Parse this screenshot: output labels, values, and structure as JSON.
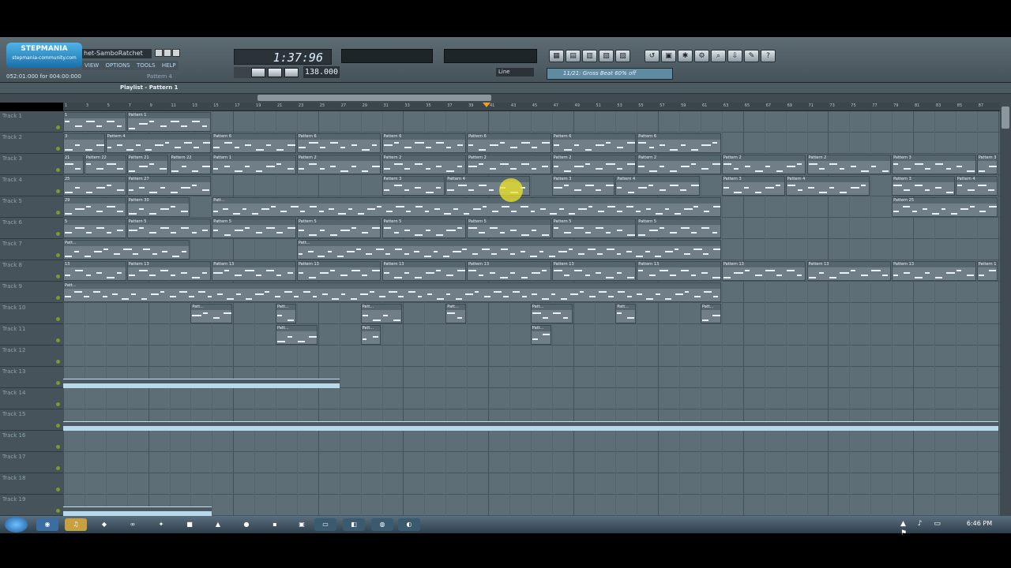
{
  "app": {
    "title": "het-SamboRatchet",
    "logo_line1": "STEPMANIA",
    "logo_line2": "stepmania-community.com",
    "accent": "#7dc2ec"
  },
  "menu": [
    "VIEW",
    "OPTIONS",
    "TOOLS",
    "HELP"
  ],
  "position_readout": "052:01:000 for 004:00:000",
  "pattern_selector": "Pattern 4",
  "song_time": "1:37:96",
  "tempo": "138.000",
  "snap": "Line",
  "hint_bar": "11/21: Gross Beat 60% off",
  "playlist_title": "Playlist - Pattern 1",
  "ruler_ticks": [
    "1",
    "3",
    "5",
    "7",
    "9",
    "11",
    "13",
    "15",
    "17",
    "19",
    "21",
    "23",
    "25",
    "27",
    "29",
    "31",
    "33",
    "35",
    "37",
    "39",
    "41",
    "43",
    "45",
    "47",
    "49",
    "51",
    "53",
    "55",
    "57",
    "59",
    "61",
    "63",
    "65",
    "67",
    "69",
    "71",
    "73",
    "75",
    "77",
    "79",
    "81",
    "83",
    "85",
    "87"
  ],
  "tracks": [
    "Track 1",
    "Track 2",
    "Track 3",
    "Track 4",
    "Track 5",
    "Track 6",
    "Track 7",
    "Track 8",
    "Track 9",
    "Track 10",
    "Track 11",
    "Track 12",
    "Track 13",
    "Track 14",
    "Track 15",
    "Track 16",
    "Track 17",
    "Track 18",
    "Track 19"
  ],
  "clips": [
    {
      "track": 1,
      "start": 0,
      "len": 3,
      "label": "1"
    },
    {
      "track": 1,
      "start": 3,
      "len": 4,
      "label": "Pattern 1"
    },
    {
      "track": 2,
      "start": 0,
      "len": 2,
      "label": "3"
    },
    {
      "track": 2,
      "start": 2,
      "len": 5,
      "label": "Pattern 4"
    },
    {
      "track": 2,
      "start": 7,
      "len": 4,
      "label": "Pattern 6"
    },
    {
      "track": 2,
      "start": 11,
      "len": 4,
      "label": "Pattern 6"
    },
    {
      "track": 2,
      "start": 15,
      "len": 4,
      "label": "Pattern 6"
    },
    {
      "track": 2,
      "start": 19,
      "len": 4,
      "label": "Pattern 6"
    },
    {
      "track": 2,
      "start": 23,
      "len": 4,
      "label": "Pattern 6"
    },
    {
      "track": 2,
      "start": 27,
      "len": 4,
      "label": "Pattern 6"
    },
    {
      "track": 3,
      "start": 0,
      "len": 1,
      "label": "21"
    },
    {
      "track": 3,
      "start": 1,
      "len": 2,
      "label": "Pattern 22"
    },
    {
      "track": 3,
      "start": 3,
      "len": 2,
      "label": "Pattern 21"
    },
    {
      "track": 3,
      "start": 5,
      "len": 2,
      "label": "Pattern 22"
    },
    {
      "track": 3,
      "start": 7,
      "len": 4,
      "label": "Pattern 1"
    },
    {
      "track": 3,
      "start": 11,
      "len": 4,
      "label": "Pattern 2"
    },
    {
      "track": 3,
      "start": 15,
      "len": 4,
      "label": "Pattern 2"
    },
    {
      "track": 3,
      "start": 19,
      "len": 4,
      "label": "Pattern 2"
    },
    {
      "track": 3,
      "start": 23,
      "len": 4,
      "label": "Pattern 2"
    },
    {
      "track": 3,
      "start": 27,
      "len": 4,
      "label": "Pattern 2"
    },
    {
      "track": 3,
      "start": 31,
      "len": 4,
      "label": "Pattern 2"
    },
    {
      "track": 3,
      "start": 35,
      "len": 4,
      "label": "Pattern 2"
    },
    {
      "track": 3,
      "start": 39,
      "len": 4,
      "label": "Pattern 3"
    },
    {
      "track": 3,
      "start": 43,
      "len": 1,
      "label": "Pattern 3"
    },
    {
      "track": 4,
      "start": 0,
      "len": 3,
      "label": "25"
    },
    {
      "track": 4,
      "start": 3,
      "len": 4,
      "label": "Pattern 27"
    },
    {
      "track": 4,
      "start": 15,
      "len": 3,
      "label": "Pattern 3"
    },
    {
      "track": 4,
      "start": 18,
      "len": 4,
      "label": "Pattern 4"
    },
    {
      "track": 4,
      "start": 23,
      "len": 3,
      "label": "Pattern 3"
    },
    {
      "track": 4,
      "start": 26,
      "len": 4,
      "label": "Pattern 4"
    },
    {
      "track": 4,
      "start": 31,
      "len": 3,
      "label": "Pattern 3"
    },
    {
      "track": 4,
      "start": 34,
      "len": 4,
      "label": "Pattern 4"
    },
    {
      "track": 4,
      "start": 39,
      "len": 3,
      "label": "Pattern 3"
    },
    {
      "track": 4,
      "start": 42,
      "len": 2,
      "label": "Pattern 4"
    },
    {
      "track": 5,
      "start": 0,
      "len": 3,
      "label": "29"
    },
    {
      "track": 5,
      "start": 3,
      "len": 3,
      "label": "Pattern 30"
    },
    {
      "track": 5,
      "start": 7,
      "len": 24,
      "label": "Patt..."
    },
    {
      "track": 5,
      "start": 39,
      "len": 5,
      "label": "Pattern 25"
    },
    {
      "track": 6,
      "start": 0,
      "len": 3,
      "label": "5"
    },
    {
      "track": 6,
      "start": 3,
      "len": 4,
      "label": "Pattern 5"
    },
    {
      "track": 6,
      "start": 7,
      "len": 4,
      "label": "Pattern 5"
    },
    {
      "track": 6,
      "start": 11,
      "len": 4,
      "label": "Pattern 5"
    },
    {
      "track": 6,
      "start": 15,
      "len": 4,
      "label": "Pattern 5"
    },
    {
      "track": 6,
      "start": 19,
      "len": 4,
      "label": "Pattern 5"
    },
    {
      "track": 6,
      "start": 23,
      "len": 4,
      "label": "Pattern 5"
    },
    {
      "track": 6,
      "start": 27,
      "len": 4,
      "label": "Pattern 5"
    },
    {
      "track": 7,
      "start": 0,
      "len": 6,
      "label": "Patt..."
    },
    {
      "track": 7,
      "start": 11,
      "len": 20,
      "label": "Patt..."
    },
    {
      "track": 8,
      "start": 0,
      "len": 3,
      "label": "13"
    },
    {
      "track": 8,
      "start": 3,
      "len": 4,
      "label": "Pattern 13"
    },
    {
      "track": 8,
      "start": 7,
      "len": 4,
      "label": "Pattern 13"
    },
    {
      "track": 8,
      "start": 11,
      "len": 4,
      "label": "Pattern 13"
    },
    {
      "track": 8,
      "start": 15,
      "len": 4,
      "label": "Pattern 13"
    },
    {
      "track": 8,
      "start": 19,
      "len": 4,
      "label": "Pattern 13"
    },
    {
      "track": 8,
      "start": 23,
      "len": 4,
      "label": "Pattern 13"
    },
    {
      "track": 8,
      "start": 27,
      "len": 4,
      "label": "Pattern 13"
    },
    {
      "track": 8,
      "start": 31,
      "len": 4,
      "label": "Pattern 13"
    },
    {
      "track": 8,
      "start": 35,
      "len": 4,
      "label": "Pattern 13"
    },
    {
      "track": 8,
      "start": 39,
      "len": 4,
      "label": "Pattern 13"
    },
    {
      "track": 8,
      "start": 43,
      "len": 1,
      "label": "Pattern 13"
    },
    {
      "track": 9,
      "start": 0,
      "len": 31,
      "label": "Patt..."
    },
    {
      "track": 10,
      "start": 6,
      "len": 2,
      "label": "Patt..."
    },
    {
      "track": 10,
      "start": 10,
      "len": 1,
      "label": "Patt..."
    },
    {
      "track": 10,
      "start": 14,
      "len": 2,
      "label": "Patt..."
    },
    {
      "track": 10,
      "start": 18,
      "len": 1,
      "label": "Patt..."
    },
    {
      "track": 10,
      "start": 22,
      "len": 2,
      "label": "Patt..."
    },
    {
      "track": 10,
      "start": 26,
      "len": 1,
      "label": "Patt..."
    },
    {
      "track": 10,
      "start": 30,
      "len": 1,
      "label": "Patt..."
    },
    {
      "track": 11,
      "start": 10,
      "len": 2,
      "label": "Patt..."
    },
    {
      "track": 11,
      "start": 14,
      "len": 1,
      "label": "Patt..."
    },
    {
      "track": 11,
      "start": 22,
      "len": 1,
      "label": "Patt..."
    }
  ],
  "automation": [
    {
      "track": 13,
      "start": 0,
      "len": 13
    },
    {
      "track": 15,
      "start": 0,
      "len": 44
    },
    {
      "track": 19,
      "start": 0,
      "len": 7
    }
  ],
  "taskbar": {
    "clock": "6:46 PM",
    "tray": "▲ ♪ ▭ ⚑"
  }
}
